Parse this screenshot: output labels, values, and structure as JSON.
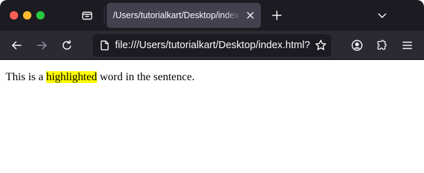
{
  "browser": {
    "tab": {
      "title": "/Users/tutorialkart/Desktop/index.html"
    },
    "urlbar": {
      "url": "file:///Users/tutorialkart/Desktop/index.html?"
    },
    "colors": {
      "tabstrip_bg": "#1c1b22",
      "toolbar_bg": "#2b2a33",
      "active_tab_bg": "#42414d",
      "traffic_close": "#ff5f57",
      "traffic_minimize": "#febc2e",
      "traffic_maximize": "#28c840"
    },
    "icons": [
      "tab-manager-icon",
      "close-icon",
      "plus-icon",
      "chevron-down-icon",
      "back-arrow-icon",
      "forward-arrow-icon",
      "reload-icon",
      "page-icon",
      "star-icon",
      "account-icon",
      "extensions-icon",
      "hamburger-menu-icon"
    ]
  },
  "page": {
    "sentence_before": "This is a ",
    "highlighted_word": "highlighted",
    "sentence_after": " word in the sentence.",
    "highlight_color": "#ffff00"
  }
}
